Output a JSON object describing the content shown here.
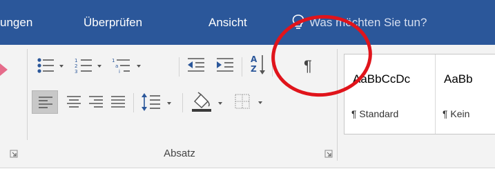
{
  "tabs": [
    {
      "label": "ungen",
      "id": "tab-sendungen"
    },
    {
      "label": "Überprüfen",
      "id": "tab-ueberpruefen"
    },
    {
      "label": "Ansicht",
      "id": "tab-ansicht"
    }
  ],
  "tell_me": {
    "placeholder": "Was möchten Sie tun?",
    "icon": "lightbulb-icon"
  },
  "paragraph_group": {
    "label": "Absatz",
    "buttons": [
      {
        "name": "bullets-button",
        "icon": "bullet-list-icon"
      },
      {
        "name": "numbering-button",
        "icon": "numbered-list-icon"
      },
      {
        "name": "multilevel-list-button",
        "icon": "multilevel-list-icon"
      },
      {
        "name": "decrease-indent-button",
        "icon": "decrease-indent-icon"
      },
      {
        "name": "increase-indent-button",
        "icon": "increase-indent-icon"
      },
      {
        "name": "sort-button",
        "icon": "sort-az-icon"
      },
      {
        "name": "show-formatting-marks-button",
        "icon": "pilcrow-icon",
        "glyph": "¶"
      },
      {
        "name": "align-left-button",
        "icon": "align-left-icon",
        "active": true
      },
      {
        "name": "align-center-button",
        "icon": "align-center-icon"
      },
      {
        "name": "align-right-button",
        "icon": "align-right-icon"
      },
      {
        "name": "justify-button",
        "icon": "justify-icon"
      },
      {
        "name": "line-spacing-button",
        "icon": "line-spacing-icon"
      },
      {
        "name": "shading-button",
        "icon": "paint-bucket-icon"
      },
      {
        "name": "borders-button",
        "icon": "borders-icon"
      }
    ]
  },
  "styles": [
    {
      "preview": "AaBbCcDc",
      "name": "¶ Standard",
      "active": true
    },
    {
      "preview": "AaBb",
      "name": "¶ Kein"
    }
  ],
  "colors": {
    "ribbon_tab_bg": "#2b579a",
    "annotation": "#e0141b",
    "accent_blue": "#2b579a"
  }
}
